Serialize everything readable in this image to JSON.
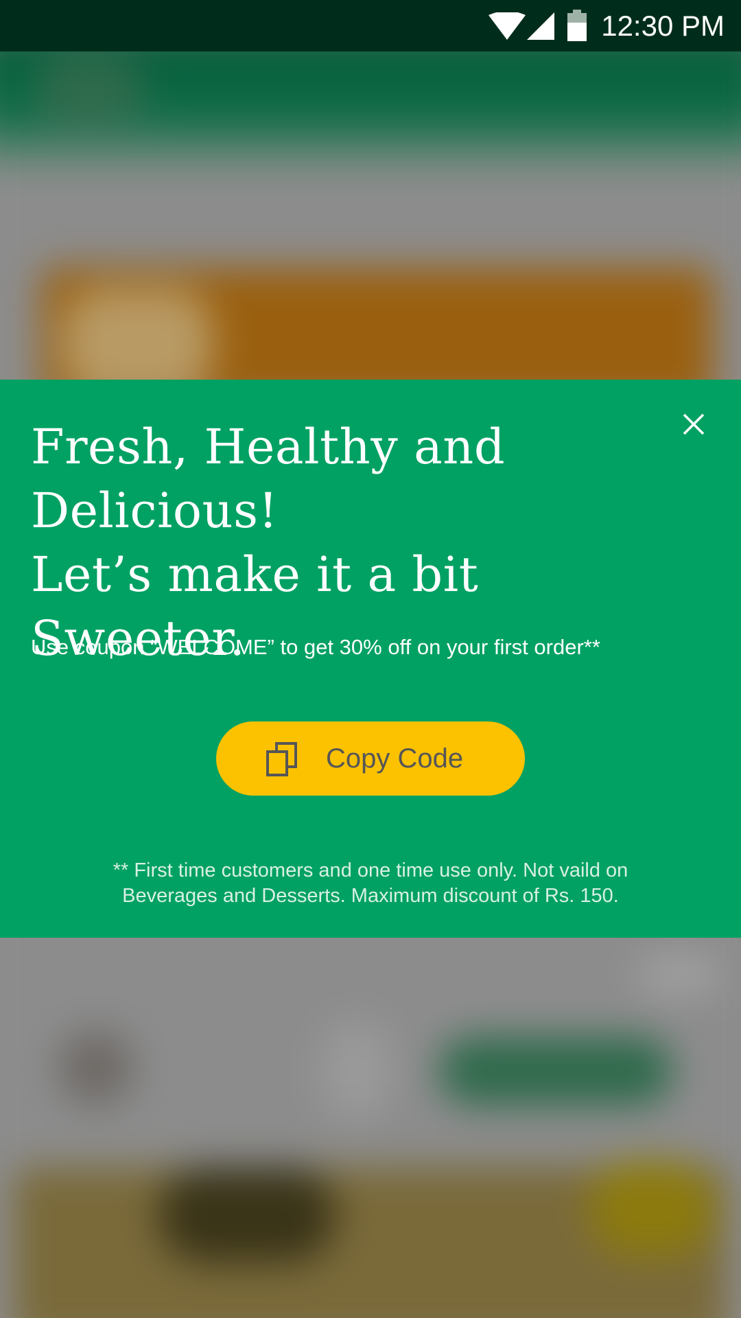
{
  "status_bar": {
    "time": "12:30 PM",
    "icons": [
      "wifi-icon",
      "cellular-signal-icon",
      "battery-icon"
    ]
  },
  "dialog": {
    "headline_lines": [
      "Fresh, Healthy and",
      "Delicious!",
      "Let’s make it a bit Sweeter."
    ],
    "coupon_text": "Use coupon “WELCOME” to get 30% off on your first order**",
    "copy_button_label": "Copy Code",
    "copy_button_icon": "copy-icon",
    "close_icon": "close-icon",
    "disclaimer_lines": [
      "** First time customers and one time use only. Not vaild on",
      "Beverages and Desserts. Maximum discount of Rs. 150."
    ]
  },
  "colors": {
    "status_bar_bg": "#002d1b",
    "dialog_bg": "#00a163",
    "button_bg": "#fcc200",
    "button_text": "#565656",
    "text": "#ffffff"
  }
}
